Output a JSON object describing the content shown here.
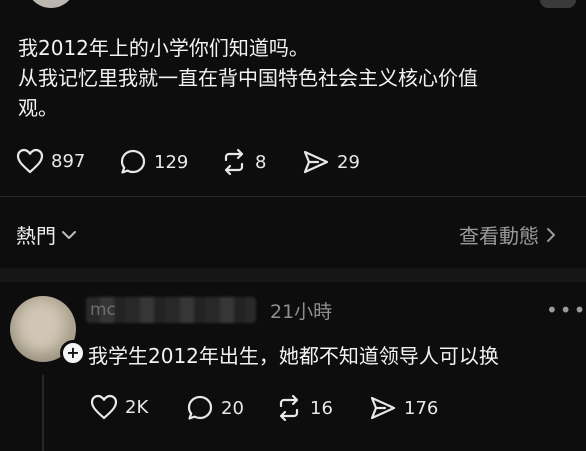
{
  "post": {
    "lines": [
      "我2012年上的小学你们知道吗。",
      "从我记忆里我就一直在背中国特色社会主义核心价值",
      "观。"
    ],
    "likes": "897",
    "replies": "129",
    "reposts": "8",
    "shares": "29"
  },
  "section": {
    "hot_label": "熱門",
    "see_all": "查看動態"
  },
  "comment": {
    "username_fragment": "mc",
    "time": "21小時",
    "more": "•••",
    "text": "我学生2012年出生，她都不知道领导人可以换",
    "likes": "2K",
    "replies": "20",
    "reposts": "16",
    "shares": "176"
  },
  "colors": {
    "background": "#0d0d0d",
    "text": "#f2f2f2",
    "muted": "#9a9a9a"
  },
  "icons": [
    "heart-icon",
    "comment-icon",
    "repost-icon",
    "share-icon",
    "chevron-down-icon",
    "chevron-right-icon",
    "plus-icon",
    "more-icon"
  ]
}
